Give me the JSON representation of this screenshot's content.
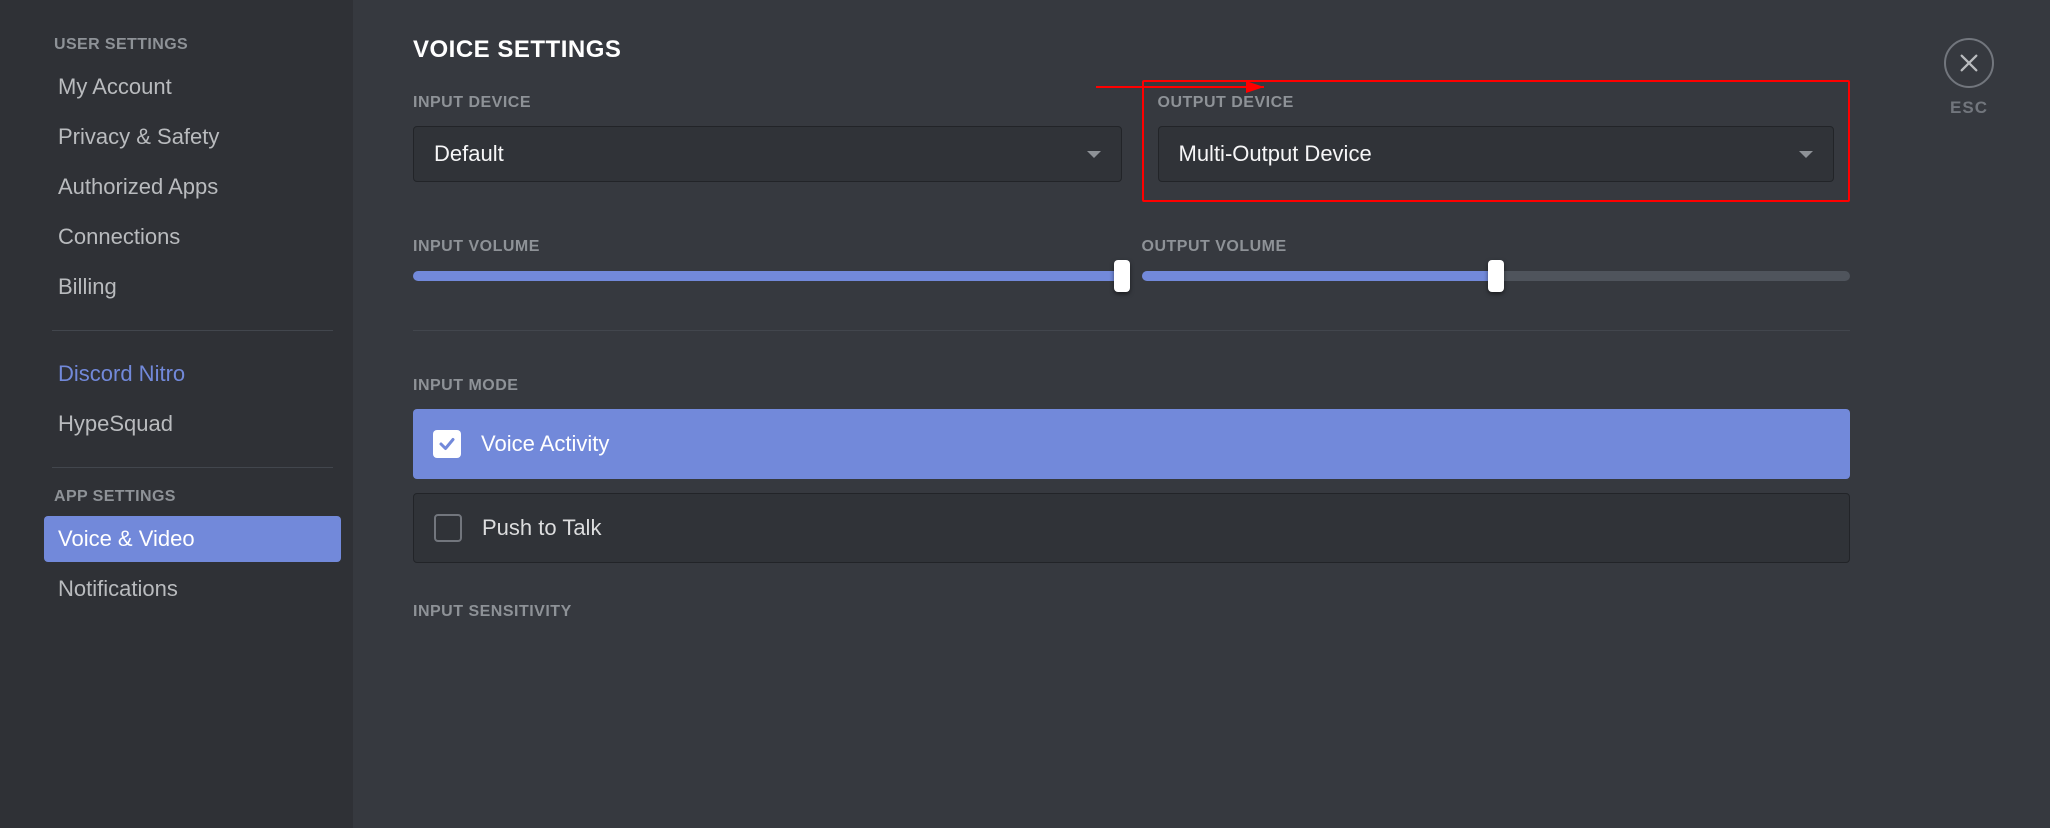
{
  "sidebar": {
    "header_user": "USER SETTINGS",
    "header_app": "APP SETTINGS",
    "items_user": [
      {
        "label": "My Account"
      },
      {
        "label": "Privacy & Safety"
      },
      {
        "label": "Authorized Apps"
      },
      {
        "label": "Connections"
      },
      {
        "label": "Billing"
      }
    ],
    "items_user2": [
      {
        "label": "Discord Nitro"
      },
      {
        "label": "HypeSquad"
      }
    ],
    "items_app": [
      {
        "label": "Voice & Video"
      },
      {
        "label": "Notifications"
      }
    ]
  },
  "main": {
    "title": "VOICE SETTINGS",
    "input_device_label": "INPUT DEVICE",
    "input_device_value": "Default",
    "output_device_label": "OUTPUT DEVICE",
    "output_device_value": "Multi-Output Device",
    "input_volume_label": "INPUT VOLUME",
    "input_volume_pct": 100,
    "output_volume_label": "OUTPUT VOLUME",
    "output_volume_pct": 50,
    "input_mode_label": "INPUT MODE",
    "mode_voice_activity": "Voice Activity",
    "mode_push_to_talk": "Push to Talk",
    "input_sensitivity_label": "INPUT SENSITIVITY"
  },
  "esc": {
    "label": "ESC"
  }
}
